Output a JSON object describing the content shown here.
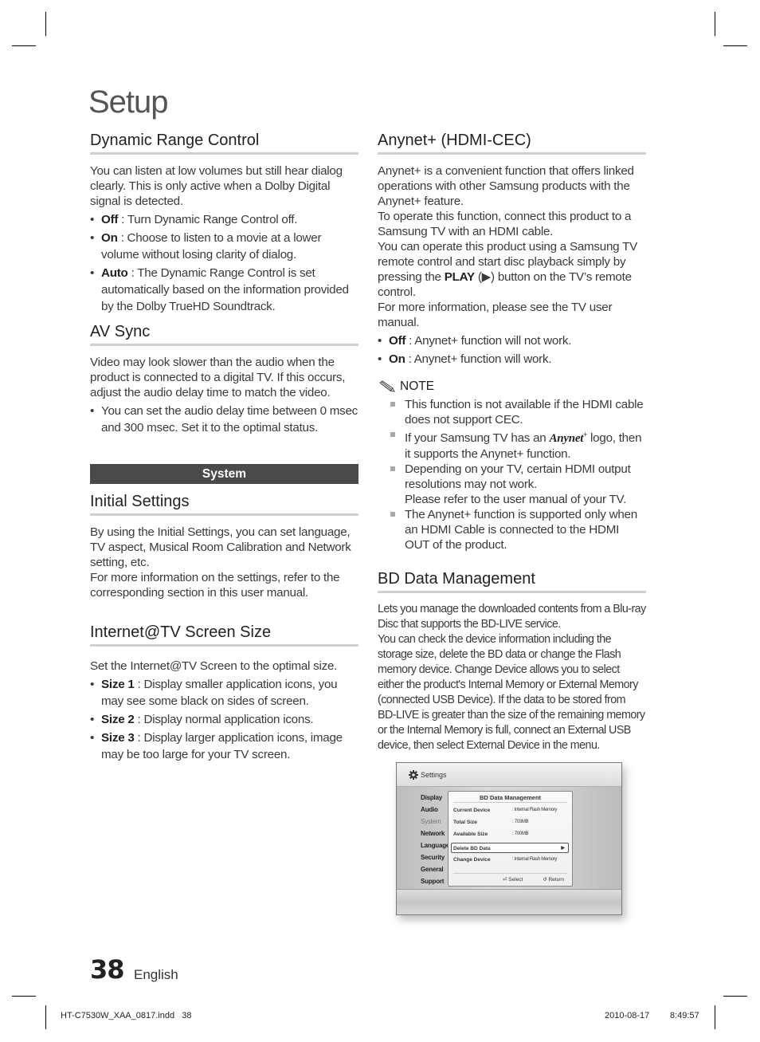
{
  "page": {
    "title": "Setup",
    "number": "38",
    "language": "English",
    "slug": {
      "file": "HT-C7530W_XAA_0817.indd   38",
      "date": "2010-08-17",
      "time": "8:49:57"
    }
  },
  "left": {
    "drc": {
      "heading": "Dynamic Range Control",
      "intro": "You can listen at low volumes but still hear dialog clearly. This is only active when a Dolby Digital signal is detected.",
      "bullets": [
        {
          "term": "Off",
          "text": " : Turn Dynamic Range Control off."
        },
        {
          "term": "On",
          "text": " : Choose to listen to a movie at a lower volume without losing clarity of dialog."
        },
        {
          "term": "Auto",
          "text": " : The Dynamic Range Control is set automatically based on the information provided by the Dolby TrueHD Soundtrack."
        }
      ]
    },
    "avsync": {
      "heading": "AV Sync",
      "intro": "Video may look slower than the audio when the product is connected to a digital TV. If this occurs, adjust the audio delay time to match the video.",
      "bullets": [
        {
          "text": "You can set the audio delay time between 0 msec and 300 msec. Set it to the optimal status."
        }
      ]
    },
    "system_bar": "System",
    "initial": {
      "heading": "Initial Settings",
      "intro": "By using the Initial Settings, you can set language, TV aspect, Musical Room Calibration and Network setting, etc.",
      "intro2": "For more information on the settings, refer to the corresponding section in this user manual."
    },
    "screensize": {
      "heading": "Internet@TV Screen Size",
      "intro": "Set the Internet@TV Screen to the optimal size.",
      "bullets": [
        {
          "term": "Size 1",
          "text": " : Display smaller application icons, you may see some black on sides of screen."
        },
        {
          "term": "Size 2",
          "text": " : Display normal application icons."
        },
        {
          "term": "Size 3",
          "text": " : Display larger application icons, image may be too large for your TV screen."
        }
      ]
    }
  },
  "right": {
    "anynet": {
      "heading": "Anynet+ (HDMI-CEC)",
      "p1": "Anynet+ is a convenient function that offers linked operations with other Samsung products with the Anynet+ feature.",
      "p2": "To operate this function, connect this product to a Samsung TV with an HDMI cable.",
      "p3_before": "You can operate this product using a Samsung TV remote control and start disc playback simply by pressing the ",
      "p3_bold": "PLAY",
      "p3_after": " (▶) button on the TV’s remote control.",
      "p4": "For more information, please see the TV user manual.",
      "bullets": [
        {
          "term": "Off",
          "text": " : Anynet+ function will not work."
        },
        {
          "term": "On",
          "text": " : Anynet+ function will work."
        }
      ],
      "note_label": "NOTE",
      "notes": [
        "This function is not available if the HDMI cable does not support CEC.",
        "logo, then it supports the Anynet+ function.",
        "Depending on your TV, certain HDMI output resolutions may not work.",
        "The Anynet+ function is supported only when an HDMI Cable is connected to the HDMI OUT of the product."
      ],
      "note2_before": "If your Samsung TV has an ",
      "note2_logo": "Anynet",
      "note3_extra": "Please refer to the user manual of your TV."
    },
    "bd": {
      "heading": "BD Data Management",
      "p1": "Lets you manage the downloaded contents from a Blu-ray Disc that supports the BD-LIVE service.",
      "p2": "You can check the device information including the storage size, delete the BD data or change the Flash memory device. Change Device allows you to select either the product's Internal Memory or External Memory (connected USB Device). If the data to be stored from BD-LIVE is greater than the size of the remaining memory or the Internal Memory is full, connect an External USB device, then select External Device in the menu."
    }
  },
  "tv_screen": {
    "title": "Settings",
    "menu": [
      "Display",
      "Audio",
      "System",
      "Network",
      "Language",
      "Security",
      "General",
      "Support"
    ],
    "active_menu": "System",
    "dialog": {
      "title": "BD Data Management",
      "rows": [
        {
          "label": "Current Device",
          "value": ": Internal Flash Memory"
        },
        {
          "label": "Total Size",
          "value": ": 703MB"
        },
        {
          "label": "Available Size",
          "value": ": 700MB"
        },
        {
          "label": "Delete BD Data",
          "value": ""
        },
        {
          "label": "Change Device",
          "value": ": Internal Flash Memory"
        }
      ],
      "selected_row": "Delete BD Data",
      "select_label": "Select",
      "return_label": "Return"
    }
  },
  "colors": {
    "system_bar": "#4a4a4a",
    "rule": "#d0d0d0",
    "note_square": "#a8a8a8"
  }
}
